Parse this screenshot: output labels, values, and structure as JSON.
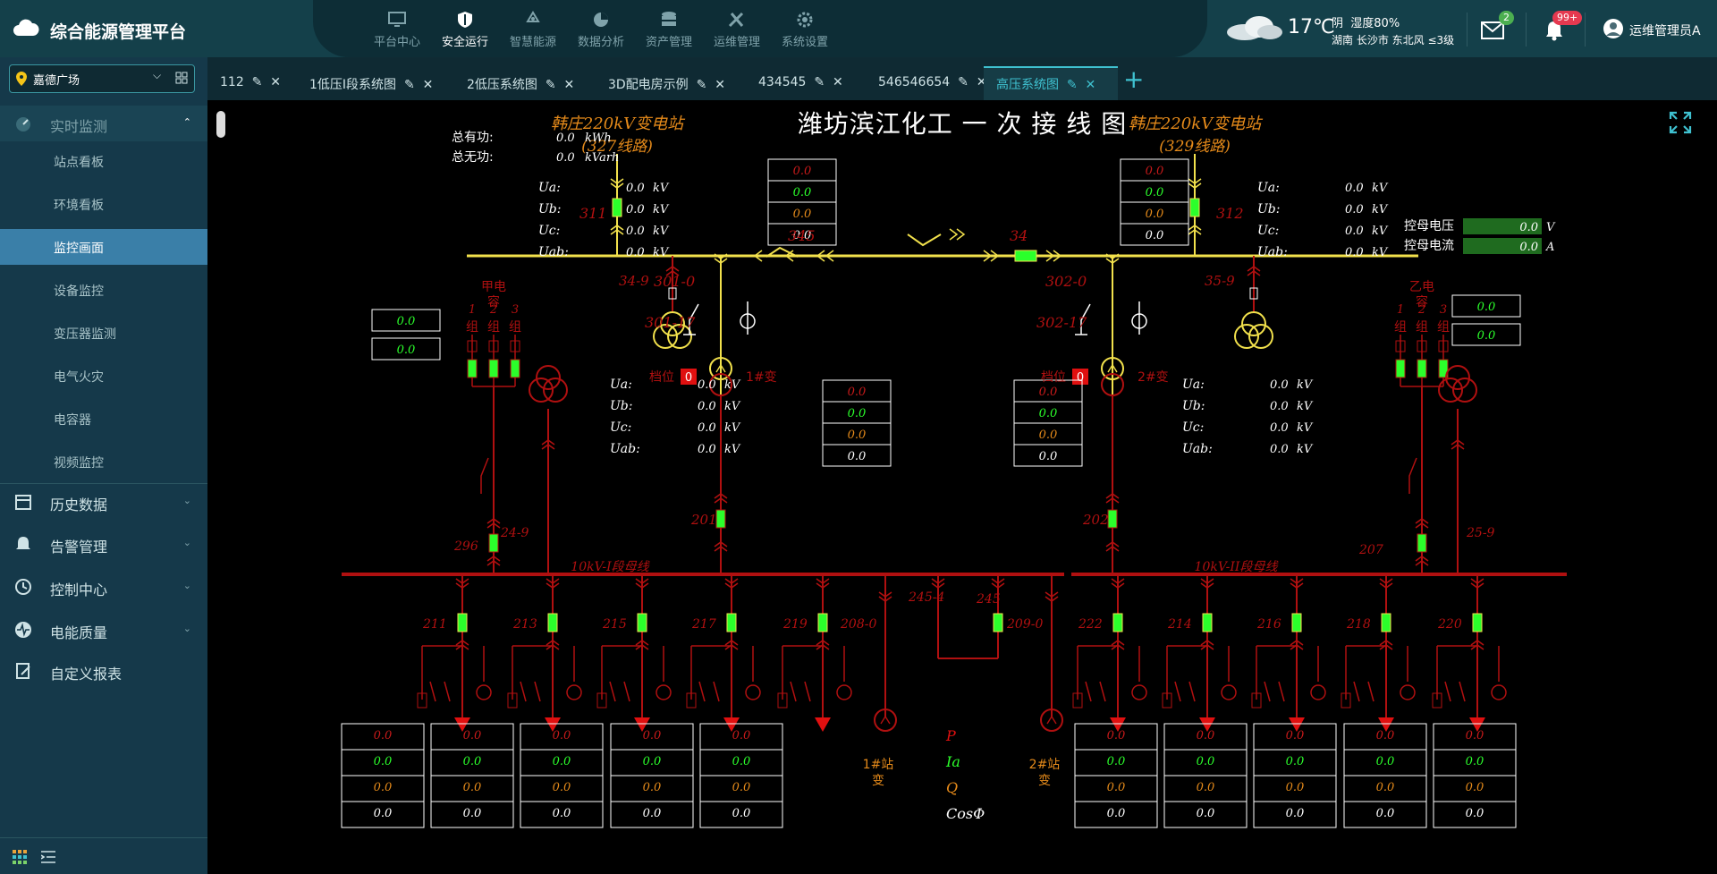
{
  "header": {
    "app_title": "综合能源管理平台",
    "nav": [
      {
        "label": "平台中心",
        "icon": "monitor-icon"
      },
      {
        "label": "安全运行",
        "icon": "shield-icon"
      },
      {
        "label": "智慧能源",
        "icon": "recycle-icon"
      },
      {
        "label": "数据分析",
        "icon": "pie-chart-icon"
      },
      {
        "label": "资产管理",
        "icon": "database-icon"
      },
      {
        "label": "运维管理",
        "icon": "tools-icon"
      },
      {
        "label": "系统设置",
        "icon": "gear-icon"
      }
    ],
    "weather": {
      "temp": "17℃",
      "condition": "阴",
      "humidity": "湿度80%",
      "location": "湖南  长沙市 东北风 ≤3级"
    },
    "mail_badge": "2",
    "notice_badge": "99+",
    "user": "运维管理员A"
  },
  "sidebar": {
    "site": "嘉德广场",
    "groups": [
      {
        "label": "实时监测",
        "expanded": true,
        "items": [
          "站点看板",
          "环境看板",
          "监控画面",
          "设备监控",
          "变压器监测",
          "电气火灾",
          "电容器",
          "视频监控"
        ]
      },
      {
        "label": "历史数据"
      },
      {
        "label": "告警管理"
      },
      {
        "label": "控制中心"
      },
      {
        "label": "电能质量"
      },
      {
        "label": "自定义报表"
      }
    ]
  },
  "tabs": [
    "112",
    "1低压I段系统图",
    "2低压系统图",
    "3D配电房示例",
    "434545",
    "546546654",
    "高压系统图"
  ],
  "diagram": {
    "title": "潍坊滨江化工 一 次 接 线 图",
    "station_left": "韩庄220kV变电站",
    "line_left": "(327线路)",
    "station_right": "韩庄220kV变电站",
    "line_right": "(329线路)",
    "total_p_label": "总有功:",
    "total_p": "0.0",
    "total_p_unit": "kWh",
    "total_q_label": "总无功:",
    "total_q": "0.0",
    "total_q_unit": "kVarh",
    "volt_labels": [
      "Ua:",
      "Ub:",
      "Uc:",
      "Uab:"
    ],
    "volt_value": "0.0",
    "volt_unit": "kV",
    "ctrl_v_label": "控母电压",
    "ctrl_v": "0.0",
    "ctrl_v_unit": "V",
    "ctrl_i_label": "控母电流",
    "ctrl_i": "0.0",
    "ctrl_i_unit": "A",
    "labels": {
      "l311": "311",
      "l312": "312",
      "l345": "345",
      "l346": "34",
      "l349": "34-9",
      "l359": "35-9",
      "l3010": "301-0",
      "l3020": "302-0",
      "l30117": "301-17",
      "l30217": "302-17",
      "l201": "201",
      "l202": "202",
      "l249": "24-9",
      "l259": "25-9",
      "l296": "296",
      "l207": "207",
      "cap_a": "甲电容",
      "cap_b": "乙电容",
      "group1": "1组",
      "group2": "2组",
      "group3": "3组",
      "tap": "档位",
      "tap_val": "0",
      "t1": "1#变",
      "t2": "2#变",
      "bus1": "10kV-I段母线",
      "bus2": "10kV-II段母线",
      "f211": "211",
      "f213": "213",
      "f215": "215",
      "f217": "217",
      "f219": "219",
      "f2080": "208-0",
      "f2454": "245-4",
      "f245": "245",
      "f2090": "209-0",
      "f222": "222",
      "f214": "214",
      "f216": "216",
      "f218": "218",
      "f220": "220",
      "st1a": "1#站",
      "st1b": "变",
      "st2a": "2#站",
      "st2b": "变",
      "row_p": "P",
      "row_ia": "Ia",
      "row_q": "Q",
      "row_cos": "CosΦ"
    },
    "cell": "0.0"
  }
}
